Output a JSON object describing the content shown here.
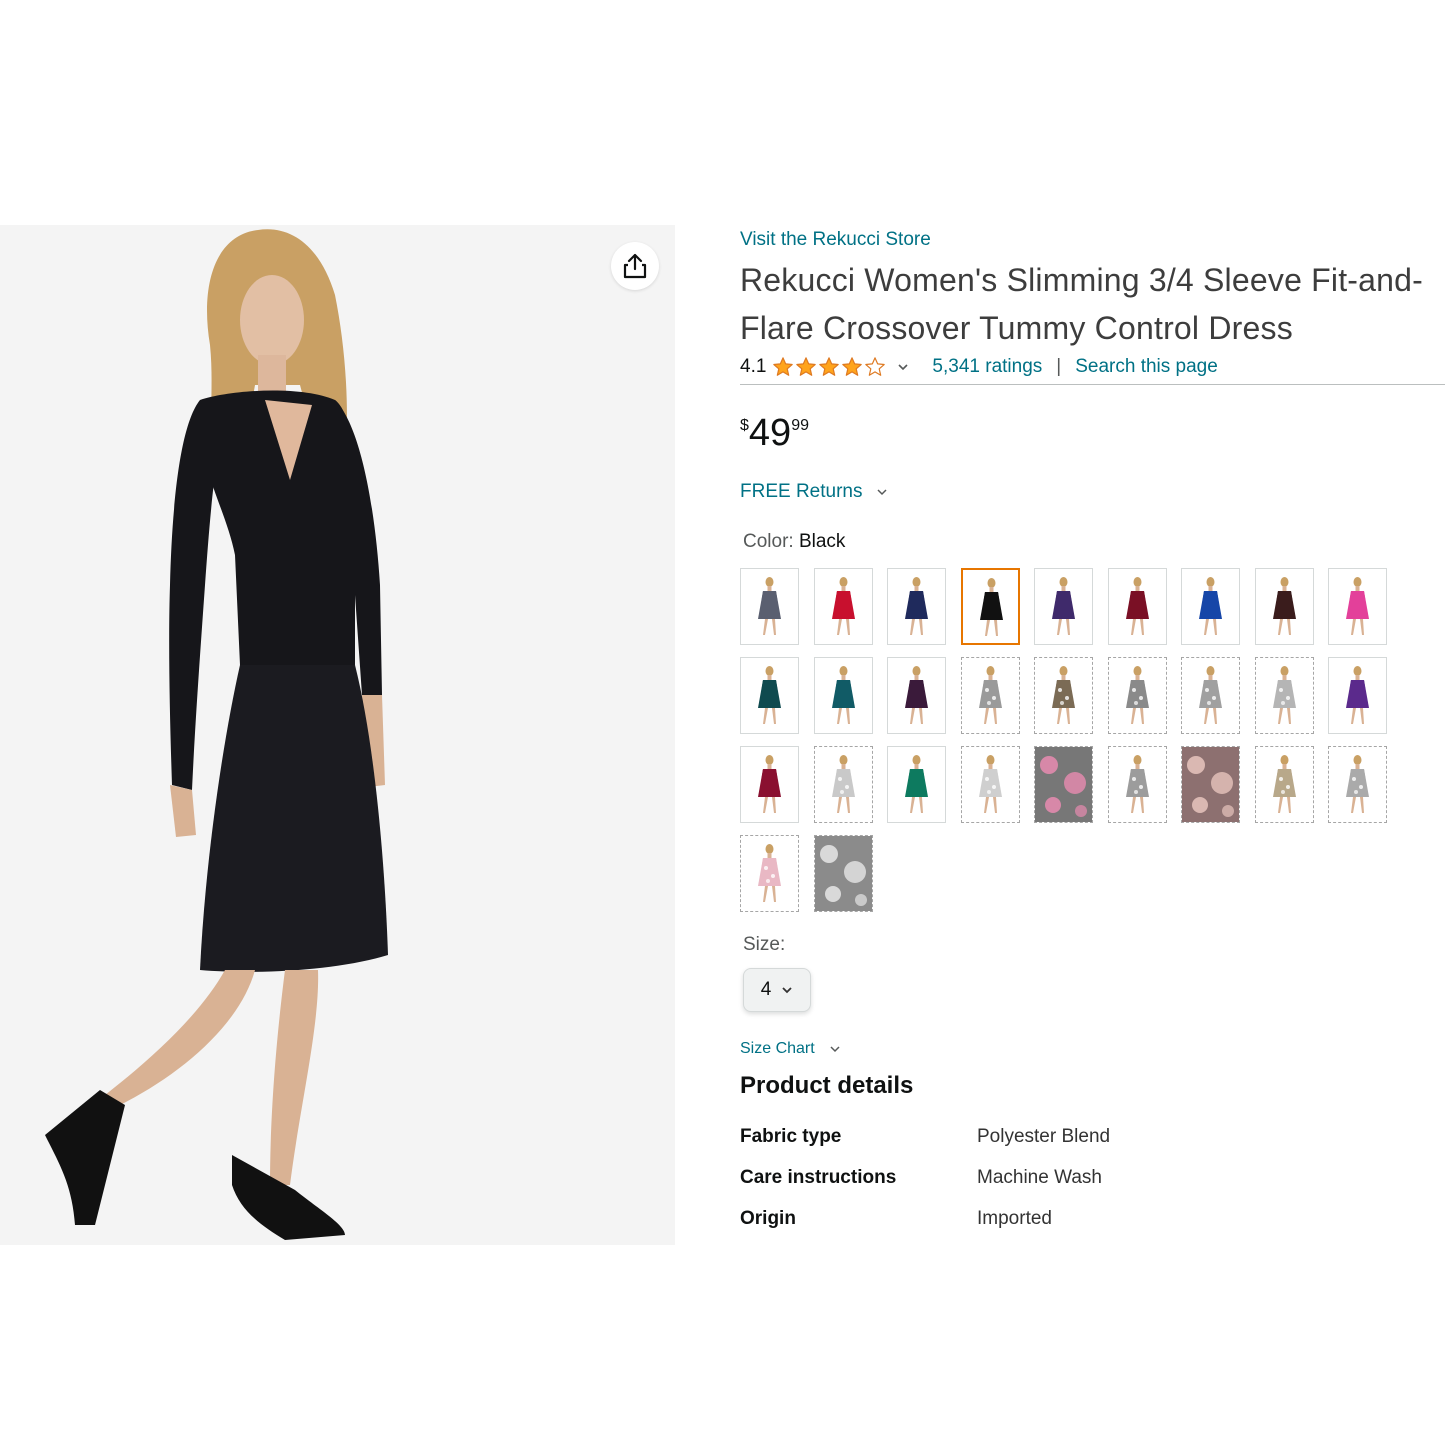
{
  "store_link": "Visit the Rekucci Store",
  "title": "Rekucci Women's Slimming 3/4 Sleeve Fit-and-Flare Crossover Tummy Control Dress",
  "rating": {
    "value": "4.1",
    "stars": 4.1,
    "ratings_count": "5,341 ratings",
    "separator": "|",
    "search_link": "Search this page"
  },
  "price": {
    "currency": "$",
    "whole": "49",
    "fraction": "99"
  },
  "returns_label": "FREE Returns",
  "color": {
    "label": "Color:",
    "selected": "Black"
  },
  "swatches": [
    {
      "color": "#5a5f70",
      "style": "solid"
    },
    {
      "color": "#c8102e",
      "style": "solid"
    },
    {
      "color": "#1f2a5c",
      "style": "solid"
    },
    {
      "color": "#111111",
      "style": "solid",
      "selected": true
    },
    {
      "color": "#3f2a6b",
      "style": "solid"
    },
    {
      "color": "#7a1025",
      "style": "solid"
    },
    {
      "color": "#1646a8",
      "style": "solid"
    },
    {
      "color": "#3a1c1c",
      "style": "solid"
    },
    {
      "color": "#e3409a",
      "style": "solid"
    },
    {
      "color": "#0f4a4f",
      "style": "solid"
    },
    {
      "color": "#115b66",
      "style": "solid"
    },
    {
      "color": "#3a1a3a",
      "style": "solid"
    },
    {
      "color": "#9a9a9a",
      "style": "print"
    },
    {
      "color": "#7b6b55",
      "style": "print"
    },
    {
      "color": "#8a8a8a",
      "style": "print"
    },
    {
      "color": "#a0a0a0",
      "style": "print"
    },
    {
      "color": "#b5b5b5",
      "style": "print"
    },
    {
      "color": "#5b2a8c",
      "style": "solid"
    },
    {
      "color": "#8a1030",
      "style": "solid"
    },
    {
      "color": "#c9c9c9",
      "style": "print"
    },
    {
      "color": "#0d7a5f",
      "style": "solid"
    },
    {
      "color": "#cfcfcf",
      "style": "print"
    },
    {
      "color": "#777777",
      "style": "fabric-pink"
    },
    {
      "color": "#9c9c9c",
      "style": "print"
    },
    {
      "color": "#8d7070",
      "style": "fabric-paisley"
    },
    {
      "color": "#b8a88a",
      "style": "print"
    },
    {
      "color": "#aaaaaa",
      "style": "print"
    },
    {
      "color": "#e9b8c4",
      "style": "print"
    },
    {
      "color": "#8b8b8b",
      "style": "fabric-floral"
    }
  ],
  "size": {
    "label": "Size:",
    "selected": "4"
  },
  "size_chart_label": "Size Chart",
  "product_details": {
    "title": "Product details",
    "rows": [
      {
        "key": "Fabric type",
        "value": "Polyester Blend"
      },
      {
        "key": "Care instructions",
        "value": "Machine Wash"
      },
      {
        "key": "Origin",
        "value": "Imported"
      }
    ]
  },
  "colors": {
    "link": "#007185",
    "star": "#ffa41c",
    "selected_border": "#e77600"
  },
  "icons": [
    "share-icon",
    "star-icon",
    "chevron-down-icon"
  ]
}
